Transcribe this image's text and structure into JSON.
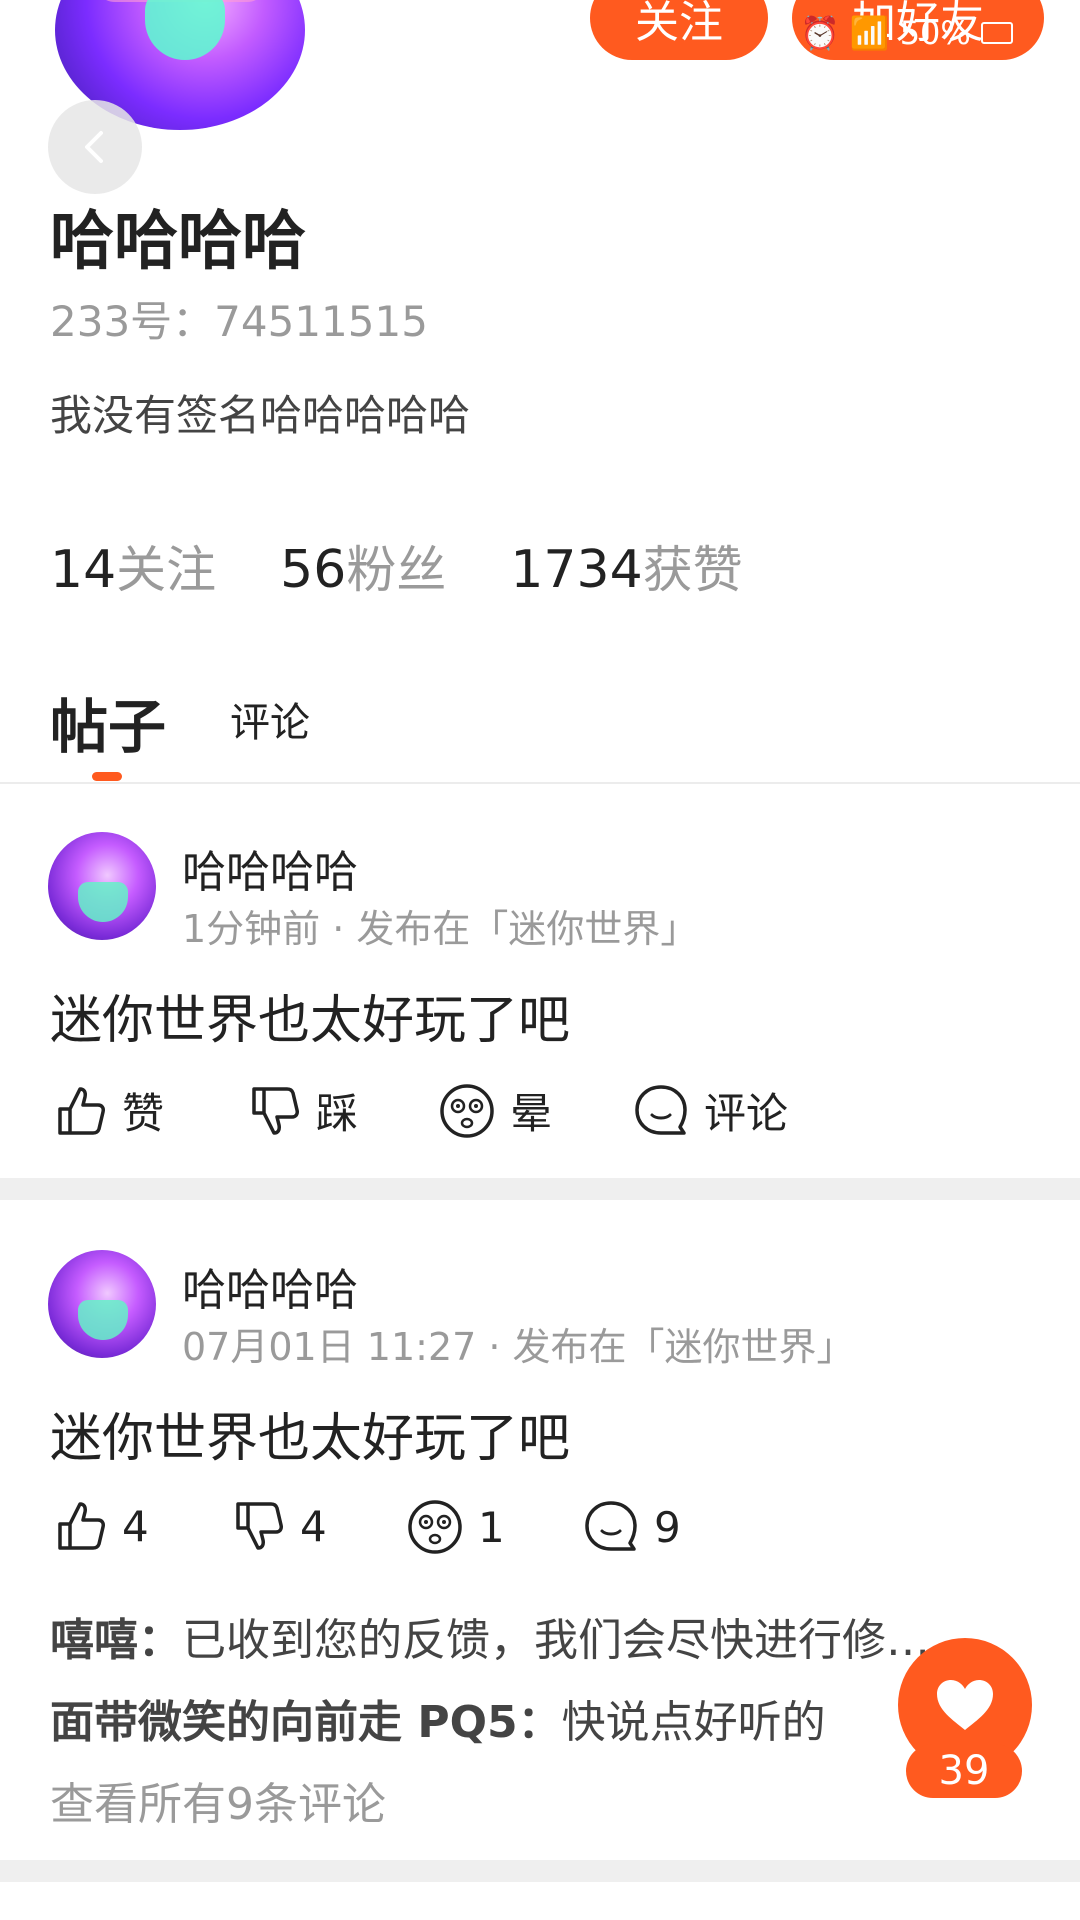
{
  "header": {
    "follow_label": "关注",
    "add_friend_label": "加好友",
    "battery": "50%"
  },
  "profile": {
    "name": "哈哈哈哈",
    "id_label": "233号：",
    "id_value": "74511515",
    "bio": "我没有签名哈哈哈哈哈",
    "stats": [
      {
        "num": "14",
        "label": "关注"
      },
      {
        "num": "56",
        "label": "粉丝"
      },
      {
        "num": "1734",
        "label": "获赞"
      }
    ]
  },
  "tabs": {
    "posts": "帖子",
    "comments": "评论"
  },
  "posts": [
    {
      "author": "哈哈哈哈",
      "meta": "1分钟前 · 发布在「迷你世界」",
      "text": "迷你世界也太好玩了吧",
      "actions": {
        "like": "赞",
        "dislike": "踩",
        "dizzy": "晕",
        "comment": "评论"
      }
    },
    {
      "author": "哈哈哈哈",
      "meta": "07月01日 11:27 · 发布在「迷你世界」",
      "text": "迷你世界也太好玩了吧",
      "actions": {
        "like": "4",
        "dislike": "4",
        "dizzy": "1",
        "comment": "9"
      },
      "comments": [
        {
          "name": "嘻嘻：",
          "text": "已收到您的反馈，我们会尽快进行修…"
        },
        {
          "name": "面带微笑的向前走 PQ5：",
          "text": "快说点好听的"
        }
      ],
      "view_all": "查看所有9条评论"
    }
  ],
  "like_fab": {
    "count": "39"
  },
  "colors": {
    "accent": "#ff5a1f",
    "muted": "#9a9a9a"
  }
}
